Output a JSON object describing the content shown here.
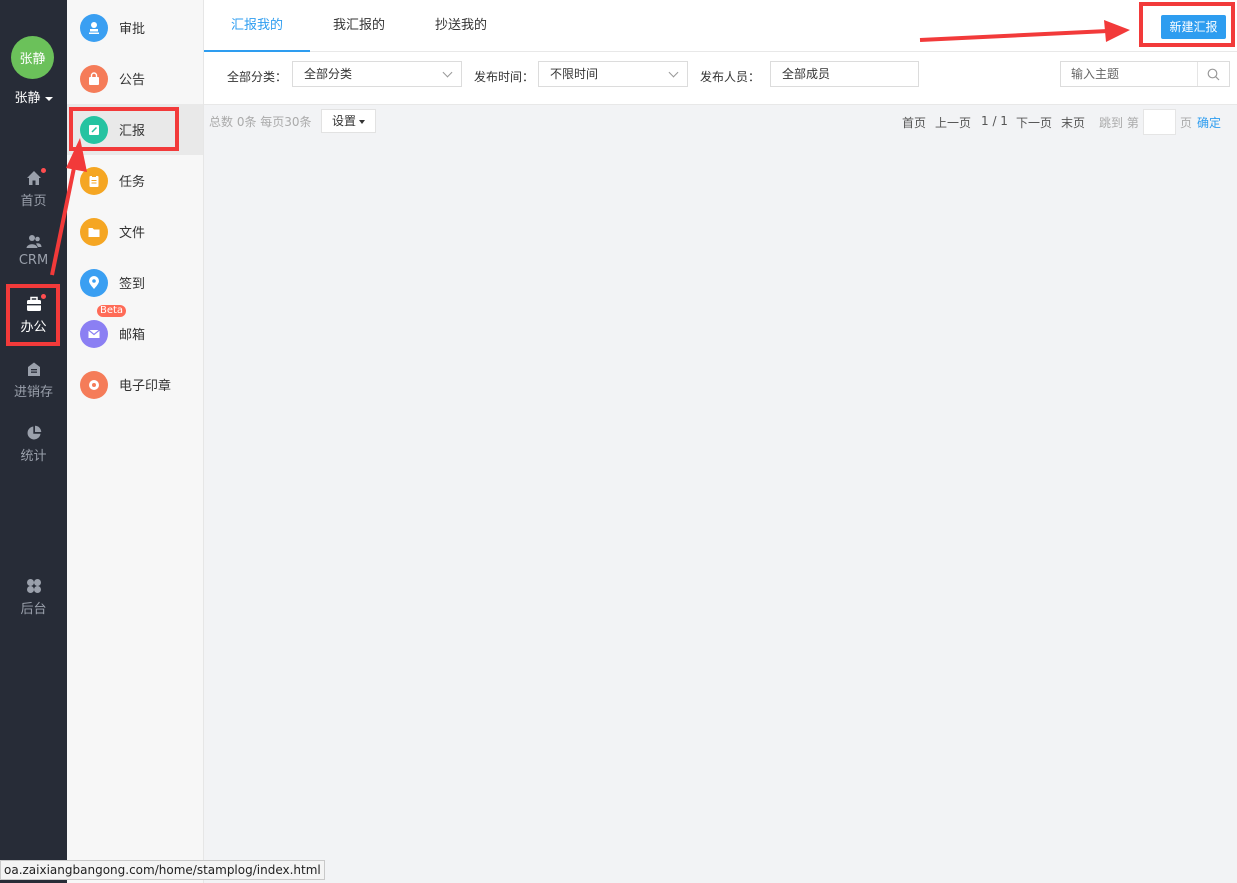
{
  "user": {
    "avatar_text": "张静",
    "name": "张静"
  },
  "leftnav": [
    {
      "key": "home",
      "label": "首页",
      "icon": "home-icon",
      "dot": true
    },
    {
      "key": "crm",
      "label": "CRM",
      "icon": "users-icon",
      "dot": false
    },
    {
      "key": "office",
      "label": "办公",
      "icon": "briefcase-icon",
      "dot": true,
      "active": true
    },
    {
      "key": "inventory",
      "label": "进销存",
      "icon": "store-icon",
      "dot": false
    },
    {
      "key": "stats",
      "label": "统计",
      "icon": "pie-chart-icon",
      "dot": false
    },
    {
      "key": "admin",
      "label": "后台",
      "icon": "grid-icon",
      "dot": false
    }
  ],
  "subnav": [
    {
      "label": "审批",
      "icon": "stamp-icon",
      "color": "#3a9ff2"
    },
    {
      "label": "公告",
      "icon": "bag-icon",
      "color": "#f57c59"
    },
    {
      "label": "汇报",
      "icon": "report-icon",
      "color": "#25c3a1",
      "active": true
    },
    {
      "label": "任务",
      "icon": "clipboard-icon",
      "color": "#f5a623"
    },
    {
      "label": "文件",
      "icon": "folder-icon",
      "color": "#f5a623"
    },
    {
      "label": "签到",
      "icon": "location-icon",
      "color": "#3a9ff2"
    },
    {
      "label": "邮箱",
      "icon": "mail-icon",
      "color": "#8b7ff3",
      "badge": "Beta"
    },
    {
      "label": "电子印章",
      "icon": "seal-icon",
      "color": "#f57c59"
    }
  ],
  "tabs": [
    {
      "label": "汇报我的",
      "active": true
    },
    {
      "label": "我汇报的"
    },
    {
      "label": "抄送我的"
    }
  ],
  "new_button": "新建汇报",
  "filters": {
    "category_label": "全部分类：",
    "category_value": "全部分类",
    "time_label": "发布时间：",
    "time_value": "不限时间",
    "person_label": "发布人员：",
    "person_value": "全部成员",
    "search_placeholder": "输入主题"
  },
  "list": {
    "count_text": "总数 0条 每页30条",
    "settings_label": "设置",
    "pager": {
      "first": "首页",
      "prev": "上一页",
      "page_info": "1 / 1",
      "next": "下一页",
      "last": "末页",
      "jump_prefix": "跳到 第",
      "jump_suffix": "页",
      "confirm": "确定"
    }
  },
  "status_url": "oa.zaixiangbangong.com/home/stamplog/index.html",
  "colors": {
    "accent": "#2e9df0",
    "nav_bg": "#272c37",
    "highlight": "#f23a3a"
  }
}
